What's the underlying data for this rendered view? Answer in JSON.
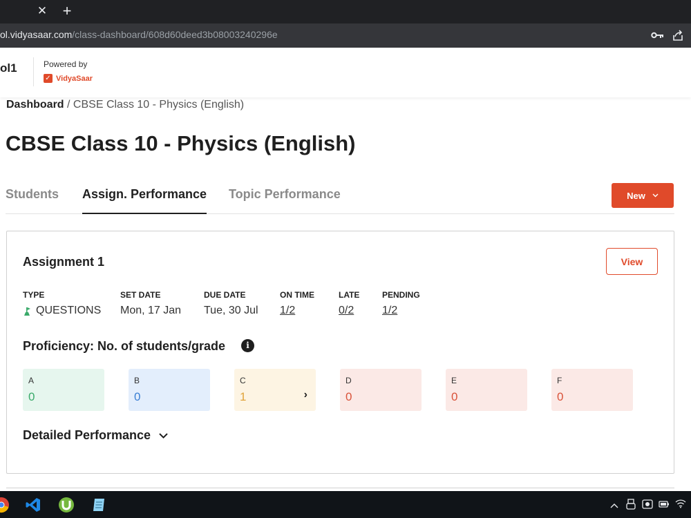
{
  "browser": {
    "tab_close_glyph": "✕",
    "new_tab_glyph": "+",
    "url_host": "ol.vidyasaar.com",
    "url_path": "/class-dashboard/608d60deed3b08003240296e",
    "icons": [
      "key-icon",
      "share-icon"
    ]
  },
  "header": {
    "school_name": "ol1",
    "powered_by": "Powered by",
    "brand_name": "VidyaSaar",
    "brand_logo_glyph": "✓",
    "brand_color": "#e04a2a"
  },
  "breadcrumb": {
    "root": "Dashboard",
    "separator": " / ",
    "current": "CBSE Class 10 - Physics (English)"
  },
  "page_title": "CBSE Class 10 - Physics (English)",
  "tabs": [
    {
      "label": "Students",
      "active": false
    },
    {
      "label": "Assign. Performance",
      "active": true
    },
    {
      "label": "Topic Performance",
      "active": false
    }
  ],
  "new_button": {
    "label": "New",
    "icon": "chevron-down-icon"
  },
  "assignment": {
    "title": "Assignment 1",
    "view_label": "View",
    "meta": {
      "type_label": "TYPE",
      "type_value": "QUESTIONS",
      "set_date_label": "SET DATE",
      "set_date_value": "Mon, 17 Jan",
      "due_date_label": "DUE DATE",
      "due_date_value": "Tue, 30 Jul",
      "on_time_label": "ON TIME",
      "on_time_value": "1/2",
      "late_label": "LATE",
      "late_value": "0/2",
      "pending_label": "PENDING",
      "pending_value": "1/2"
    },
    "proficiency_title": "Proficiency: No. of students/grade",
    "info_glyph": "i",
    "grades": [
      {
        "letter": "A",
        "count": "0",
        "bg": "#e6f6ee",
        "fg": "#3aaa6a"
      },
      {
        "letter": "B",
        "count": "0",
        "bg": "#e3eefc",
        "fg": "#3a7fd4"
      },
      {
        "letter": "C",
        "count": "1",
        "bg": "#fdf4e3",
        "fg": "#e0a33a",
        "chevron": "›"
      },
      {
        "letter": "D",
        "count": "0",
        "bg": "#fbe9e6",
        "fg": "#d9533a"
      },
      {
        "letter": "E",
        "count": "0",
        "bg": "#fbe9e6",
        "fg": "#d9533a"
      },
      {
        "letter": "F",
        "count": "0",
        "bg": "#fbe9e6",
        "fg": "#d9533a"
      }
    ],
    "detailed_label": "Detailed Performance",
    "detailed_icon": "chevron-down-icon"
  },
  "taskbar": {
    "apps": [
      "chrome-icon",
      "vscode-icon",
      "utorrent-icon",
      "notepad-icon"
    ],
    "tray": [
      "chevron-up-icon",
      "usb-icon",
      "app-tray-icon",
      "battery-icon",
      "wifi-icon"
    ]
  }
}
